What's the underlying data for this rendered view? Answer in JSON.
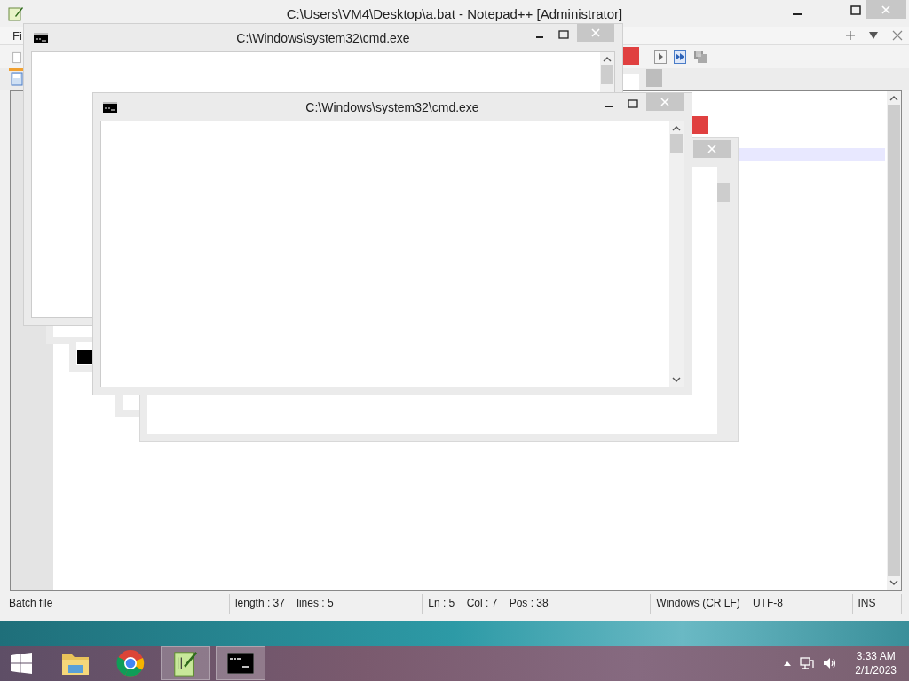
{
  "notepad": {
    "title": "C:\\Users\\VM4\\Desktop\\a.bat - Notepad++ [Administrator]",
    "menu": [
      "Fi"
    ],
    "status": [
      "Batch file",
      "length : 37    lines : 5",
      "Ln : 5    Col : 7    Pos : 38",
      "Windows (CR LF)",
      "UTF-8",
      "INS"
    ]
  },
  "cmd_windows": [
    {
      "title": "C:\\Windows\\system32\\cmd.exe"
    },
    {
      "title": "C:\\Windows\\system32\\cmd.exe"
    }
  ],
  "taskbar": {
    "apps": [
      {
        "kind": "explorer",
        "selected": false
      },
      {
        "kind": "chrome",
        "selected": false
      },
      {
        "kind": "notepad",
        "selected": true
      },
      {
        "kind": "cmd",
        "selected": true
      }
    ],
    "time": "3:33 AM",
    "date": "2/1/2023"
  }
}
